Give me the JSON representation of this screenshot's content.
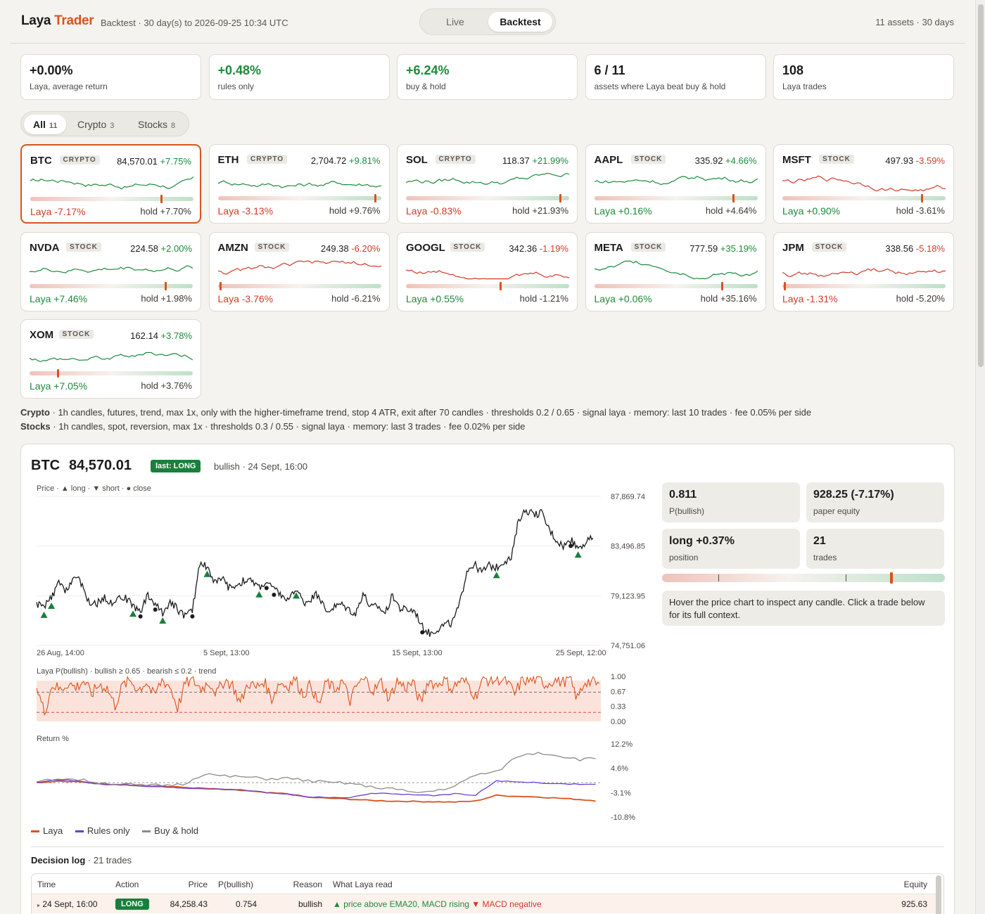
{
  "header": {
    "brand_a": "Laya",
    "brand_b": "Trader",
    "subtitle": "Backtest · 30 day(s) to 2026-09-25 10:34 UTC",
    "modes": [
      "Live",
      "Backtest"
    ],
    "summary": "11 assets · 30 days"
  },
  "stats": [
    {
      "value": "+0.00%",
      "label": "Laya, average return",
      "tone": "neutral"
    },
    {
      "value": "+0.48%",
      "label": "rules only",
      "tone": "green"
    },
    {
      "value": "+6.24%",
      "label": "buy & hold",
      "tone": "green"
    },
    {
      "value": "6 / 11",
      "label": "assets where Laya beat buy & hold",
      "tone": "neutral"
    },
    {
      "value": "108",
      "label": "Laya trades",
      "tone": "neutral"
    }
  ],
  "filters": [
    {
      "label": "All",
      "count": "11"
    },
    {
      "label": "Crypto",
      "count": "3"
    },
    {
      "label": "Stocks",
      "count": "8"
    }
  ],
  "assets": [
    {
      "symbol": "BTC",
      "tag": "CRYPTO",
      "price": "84,570.01",
      "change": "+7.75%",
      "laya": "Laya -7.17%",
      "hold": "hold +7.70%",
      "marker": 0.81,
      "trend": "up",
      "selected": true
    },
    {
      "symbol": "ETH",
      "tag": "CRYPTO",
      "price": "2,704.72",
      "change": "+9.81%",
      "laya": "Laya -3.13%",
      "hold": "hold +9.76%",
      "marker": 0.97,
      "trend": "up"
    },
    {
      "symbol": "SOL",
      "tag": "CRYPTO",
      "price": "118.37",
      "change": "+21.99%",
      "laya": "Laya -0.83%",
      "hold": "hold +21.93%",
      "marker": 0.95,
      "trend": "up"
    },
    {
      "symbol": "AAPL",
      "tag": "STOCK",
      "price": "335.92",
      "change": "+4.66%",
      "laya": "Laya +0.16%",
      "hold": "hold +4.64%",
      "marker": 0.86,
      "trend": "up"
    },
    {
      "symbol": "MSFT",
      "tag": "STOCK",
      "price": "497.93",
      "change": "-3.59%",
      "laya": "Laya +0.90%",
      "hold": "hold -3.61%",
      "marker": 0.86,
      "trend": "down"
    },
    {
      "symbol": "NVDA",
      "tag": "STOCK",
      "price": "224.58",
      "change": "+2.00%",
      "laya": "Laya +7.46%",
      "hold": "hold +1.98%",
      "marker": 0.84,
      "trend": "up"
    },
    {
      "symbol": "AMZN",
      "tag": "STOCK",
      "price": "249.38",
      "change": "-6.20%",
      "laya": "Laya -3.76%",
      "hold": "hold -6.21%",
      "marker": 0.01,
      "trend": "down"
    },
    {
      "symbol": "GOOGL",
      "tag": "STOCK",
      "price": "342.36",
      "change": "-1.19%",
      "laya": "Laya +0.55%",
      "hold": "hold -1.21%",
      "marker": 0.58,
      "trend": "down"
    },
    {
      "symbol": "META",
      "tag": "STOCK",
      "price": "777.59",
      "change": "+35.19%",
      "laya": "Laya +0.06%",
      "hold": "hold +35.16%",
      "marker": 0.79,
      "trend": "up"
    },
    {
      "symbol": "JPM",
      "tag": "STOCK",
      "price": "338.56",
      "change": "-5.18%",
      "laya": "Laya -1.31%",
      "hold": "hold -5.20%",
      "marker": 0.01,
      "trend": "down"
    },
    {
      "symbol": "XOM",
      "tag": "STOCK",
      "price": "162.14",
      "change": "+3.78%",
      "laya": "Laya +7.05%",
      "hold": "hold +3.76%",
      "marker": 0.17,
      "trend": "up"
    }
  ],
  "config": {
    "crypto_label": "Crypto",
    "crypto_text": " · 1h candles, futures, trend, max 1x, only with the higher-timeframe trend, stop 4 ATR, exit after 70 candles · thresholds 0.2 / 0.65 · signal laya · memory: last 10 trades · fee 0.05% per side",
    "stocks_label": "Stocks",
    "stocks_text": " · 1h candles, spot, reversion, max 1x · thresholds 0.3 / 0.55 · signal laya · memory: last 3 trades · fee 0.02% per side"
  },
  "detail": {
    "symbol": "BTC",
    "price": "84,570.01",
    "badge": "last: LONG",
    "note": "bullish · 24 Sept, 16:00",
    "price_caption": "Price · ▲ long · ▼ short · ● close",
    "pbull_caption": "Laya P(bullish) · bullish ≥ 0.65 · bearish ≤ 0.2 · trend",
    "return_caption": "Return %",
    "metrics": [
      {
        "value": "0.811",
        "label": "P(bullish)"
      },
      {
        "value": "928.25 (-7.17%)",
        "label": "paper equity"
      },
      {
        "value": "long +0.37%",
        "label": "position"
      },
      {
        "value": "21",
        "label": "trades"
      }
    ],
    "gauge_value": 0.811,
    "gauge_thresholds": [
      0.2,
      0.65
    ],
    "hint": "Hover the price chart to inspect any candle. Click a trade below for its full context.",
    "legend": [
      "Laya",
      "Rules only",
      "Buy & hold"
    ],
    "colors": {
      "laya": "#d9531e",
      "rules": "#6a3fd8",
      "hold": "#8e8b86",
      "long": "#1a7f3c",
      "short": "#d23a2a"
    }
  },
  "chart_data": [
    {
      "type": "line",
      "title": "Price",
      "x_ticks": [
        "26 Aug, 14:00",
        "5 Sept, 13:00",
        "15 Sept, 13:00",
        "25 Sept, 12:00"
      ],
      "y_ticks": [
        "87,869.74",
        "83,496.85",
        "79,123.95",
        "74,751.06"
      ],
      "ylim": [
        74751.06,
        87869.74
      ],
      "series": [
        {
          "values": [
            78400,
            78100,
            78900,
            80200,
            79600,
            80800,
            80300,
            78600,
            78300,
            79000,
            78500,
            79100,
            78900,
            78200,
            77800,
            79200,
            78400,
            77600,
            78700,
            77900,
            77400,
            77800,
            82100,
            81700,
            80300,
            80600,
            79800,
            80100,
            80500,
            80400,
            79900,
            80300,
            79700,
            79200,
            78600,
            79800,
            78500,
            78900,
            79300,
            77700,
            78100,
            78400,
            78000,
            77500,
            79400,
            78100,
            78200,
            77600,
            79200,
            78000,
            77900,
            77800,
            76400,
            75800,
            76200,
            76600,
            76700,
            78300,
            81400,
            81900,
            81200,
            81800,
            81600,
            82200,
            82400,
            85900,
            86700,
            86200,
            86500,
            85100,
            84100,
            83500,
            84000,
            83400,
            83800,
            84200
          ]
        }
      ]
    },
    {
      "type": "line",
      "title": "Laya P(bullish)",
      "y_ticks": [
        "1.00",
        "0.67",
        "0.33",
        "0.00"
      ],
      "ylim": [
        0,
        1
      ],
      "thresholds": [
        0.65,
        0.2
      ],
      "series": [
        {
          "values": [
            0.76,
            0.2,
            0.82,
            0.7,
            0.85,
            0.75,
            0.9,
            0.6,
            0.82,
            0.74,
            0.35,
            0.8,
            0.9,
            0.7,
            0.88,
            0.55,
            0.92,
            0.78,
            0.3,
            0.85,
            0.9,
            0.72,
            0.88,
            0.62,
            0.93,
            0.8,
            0.4,
            0.86,
            0.74,
            0.9,
            0.5,
            0.87,
            0.78,
            0.95,
            0.6,
            0.82,
            0.35,
            0.88,
            0.7,
            0.9,
            0.45,
            0.84,
            0.93,
            0.68,
            0.88,
            0.5,
            0.9,
            0.75,
            0.86,
            0.4,
            0.92,
            0.8,
            0.95,
            0.72,
            0.9,
            0.85,
            0.55,
            0.95,
            0.9,
            0.94,
            0.88,
            0.6,
            0.93,
            0.9,
            0.95,
            0.82,
            0.92,
            0.88,
            0.94,
            0.5,
            0.9,
            0.86,
            0.8
          ]
        }
      ]
    },
    {
      "type": "line",
      "title": "Return %",
      "y_ticks": [
        "12.2%",
        "4.6%",
        "-3.1%",
        "-10.8%"
      ],
      "ylim": [
        -10.8,
        12.2
      ],
      "series": [
        {
          "name": "Laya",
          "values": [
            0.0,
            0.5,
            0.3,
            -0.4,
            -0.6,
            -0.9,
            -1.1,
            -1.5,
            -1.8,
            -2.2,
            -2.5,
            -3.2,
            -3.5,
            -4.6,
            -4.9,
            -5.2,
            -5.6,
            -5.8,
            -5.9,
            -6.0,
            -6.1,
            -5.8,
            -4.0,
            -4.3,
            -4.5,
            -4.9,
            -5.3,
            -5.8
          ]
        },
        {
          "name": "Rules only",
          "values": [
            0.0,
            0.9,
            0.6,
            -0.5,
            -0.7,
            -1.1,
            -1.4,
            -1.7,
            -1.9,
            -2.0,
            -2.4,
            -3.1,
            -3.6,
            -4.5,
            -4.6,
            -4.8,
            -3.3,
            -3.5,
            -3.8,
            -4.1,
            -3.5,
            -3.9,
            0.5,
            0.3,
            0.0,
            -0.4,
            -0.5,
            -0.6
          ]
        },
        {
          "name": "Buy & hold",
          "values": [
            0.0,
            1.4,
            1.0,
            0.0,
            -0.4,
            -0.9,
            -0.8,
            -0.5,
            2.8,
            2.0,
            1.8,
            1.2,
            1.4,
            0.6,
            0.0,
            -0.2,
            -1.4,
            -1.8,
            -3.2,
            -2.6,
            -1.2,
            2.5,
            3.3,
            8.3,
            9.5,
            8.5,
            7.3,
            7.7
          ]
        }
      ]
    }
  ],
  "log": {
    "title": "Decision log",
    "count": " · 21 trades",
    "headers": [
      "Time",
      "Action",
      "Price",
      "P(bullish)",
      "Reason",
      "What Laya read",
      "Equity"
    ],
    "rows": [
      {
        "time": "24 Sept, 16:00",
        "action": "LONG",
        "price": "84,258.43",
        "pbull": "0.754",
        "reason": "bullish",
        "read_pos": "▲ price above EMA20, MACD rising",
        "read_neg": "▼ MACD negative",
        "equity": "925.63"
      }
    ]
  }
}
